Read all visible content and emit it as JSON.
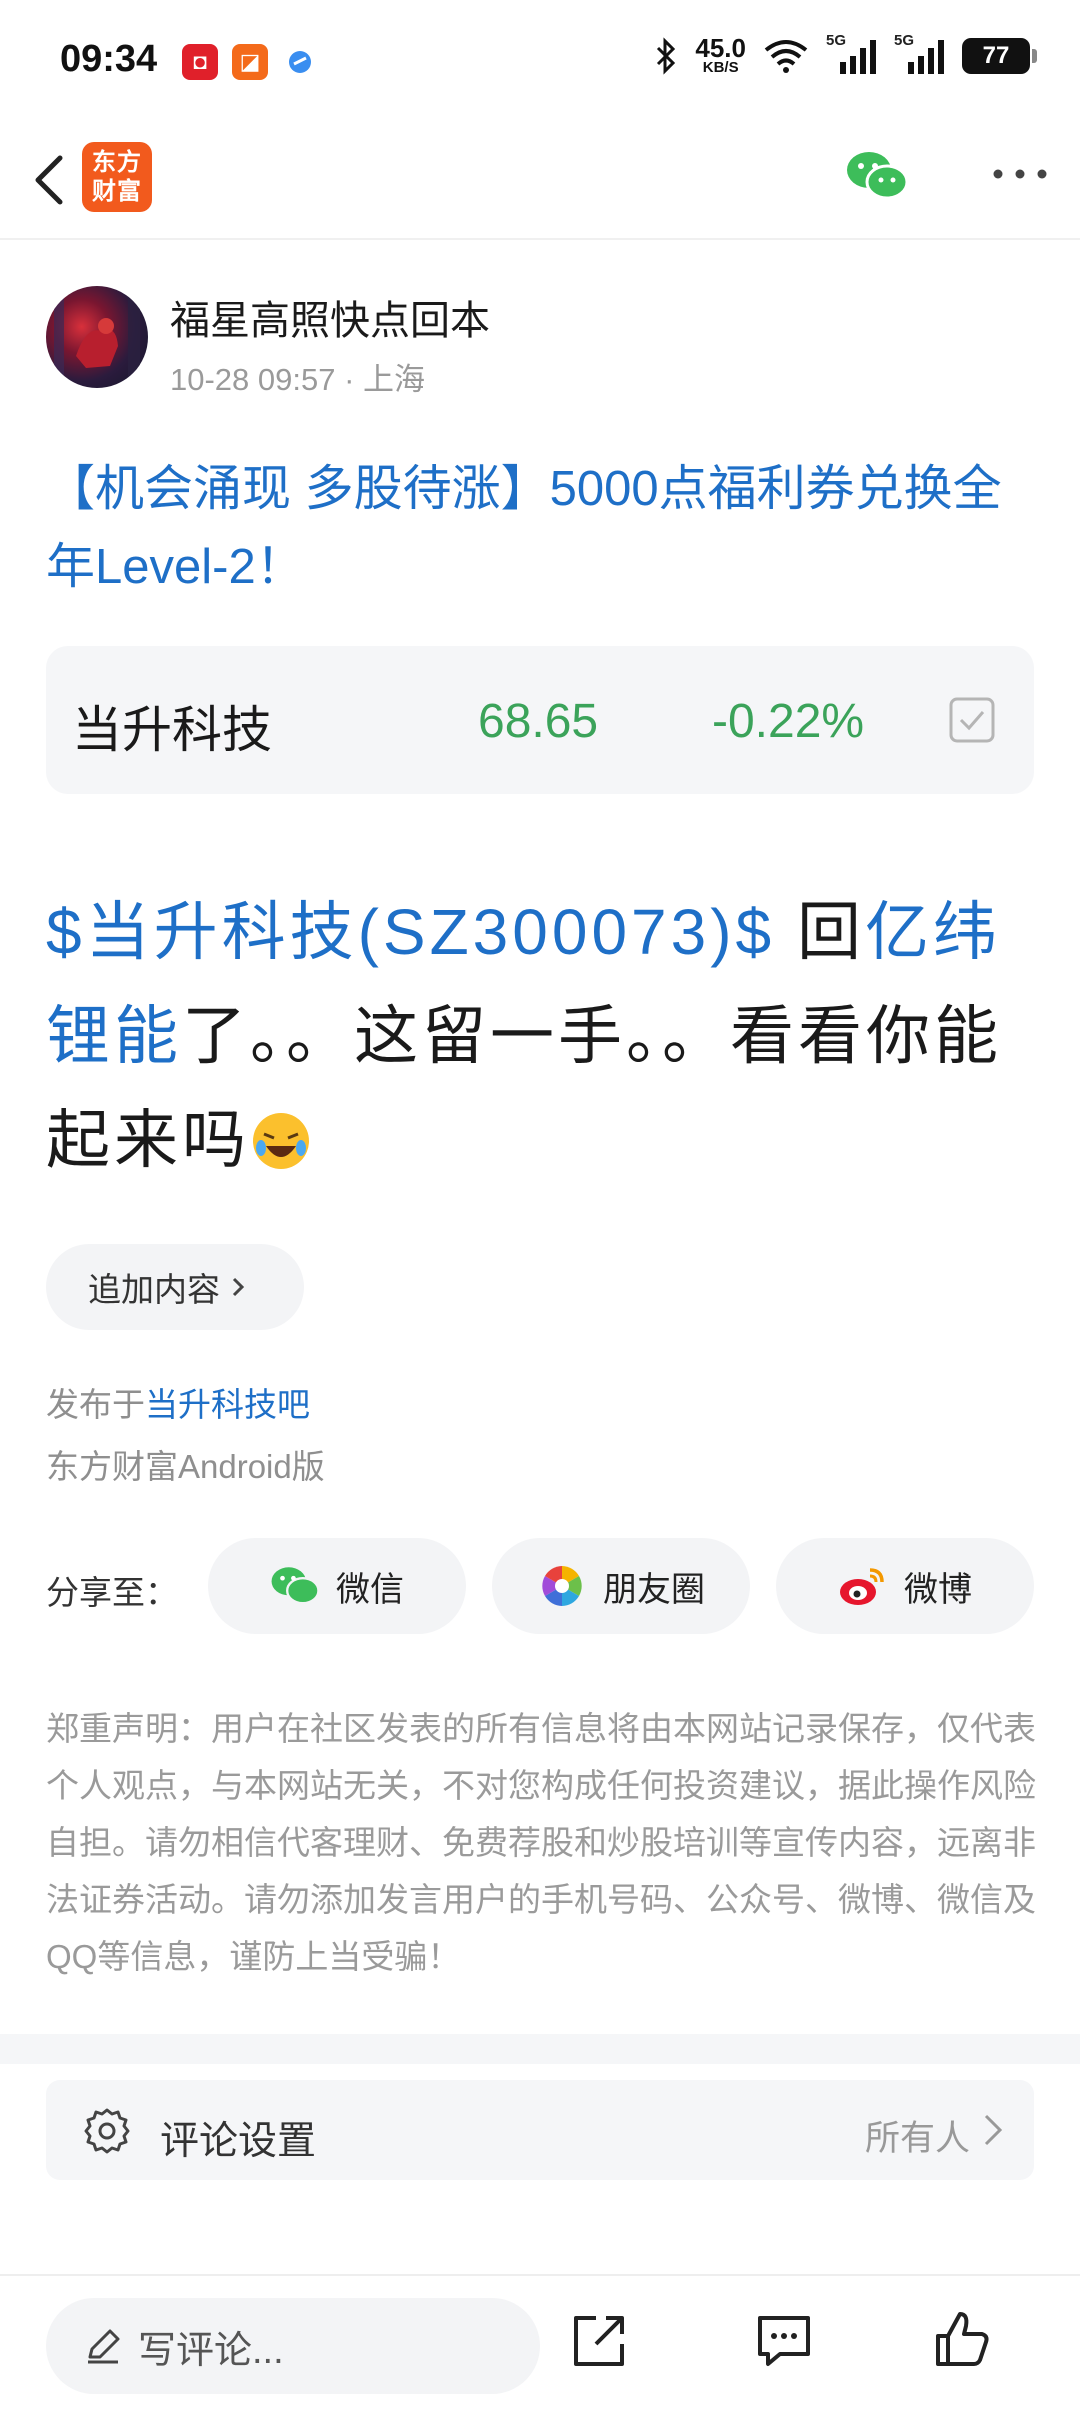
{
  "status_bar": {
    "time": "09:34",
    "net_speed_value": "45.0",
    "net_speed_unit": "KB/S",
    "signal1": "5G",
    "signal2": "5G",
    "battery": "77"
  },
  "nav": {
    "logo_line1": "东方",
    "logo_line2": "财富",
    "icons": [
      "back-arrow-icon",
      "wechat-icon",
      "more-icon"
    ]
  },
  "author": {
    "name": "福星高照快点回本",
    "meta": "10-28 09:57 · 上海"
  },
  "promo_banner": "【机会涌现 多股待涨】5000点福利券兑换全年Level-2！",
  "stock": {
    "name": "当升科技",
    "price": "68.65",
    "change": "-0.22%"
  },
  "post": {
    "stock_tag": "$当升科技(SZ300073)$",
    "text_part1": "回",
    "mention": "亿纬锂能",
    "text_part2": "了。。这留一手。。看看你能起来吗"
  },
  "append_button": "追加内容",
  "publish": {
    "prefix": "发布于",
    "bar": "当升科技吧",
    "client": "东方财富Android版"
  },
  "share": {
    "label": "分享至：",
    "targets": [
      "微信",
      "朋友圈",
      "微博"
    ]
  },
  "disclaimer": "郑重声明：用户在社区发表的所有信息将由本网站记录保存，仅代表个人观点，与本网站无关，不对您构成任何投资建议，据此操作风险自担。请勿相信代客理财、免费荐股和炒股培训等宣传内容，远离非法证券活动。请勿添加发言用户的手机号码、公众号、微博、微信及QQ等信息，谨防上当受骗！",
  "comment_settings": {
    "label": "评论设置",
    "value": "所有人"
  },
  "bottom_bar": {
    "comment_placeholder": "写评论..."
  },
  "colors": {
    "link_blue": "#1e6fc7",
    "stock_green": "#3ba35a",
    "brand_orange": "#f25a1d"
  }
}
